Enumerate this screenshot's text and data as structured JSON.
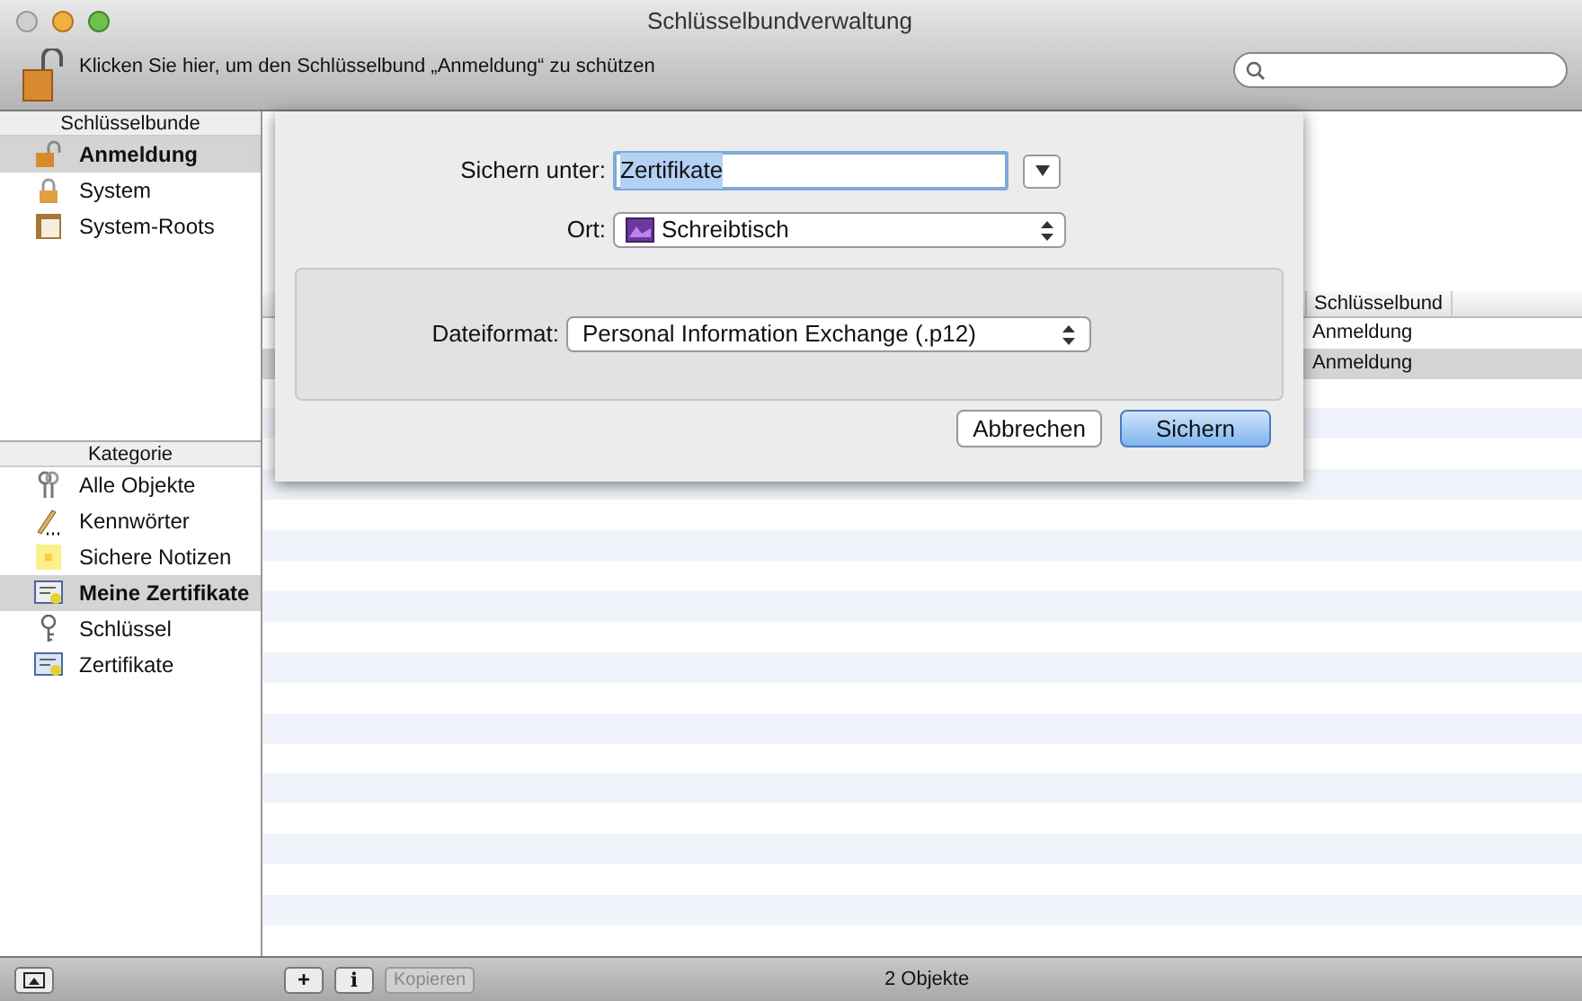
{
  "window": {
    "title": "Schlüsselbundverwaltung"
  },
  "toolbar": {
    "lock_text": "Klicken Sie hier, um den Schlüsselbund „Anmeldung“ zu schützen"
  },
  "keychains": {
    "header": "Schlüsselbunde",
    "items": [
      {
        "label": "Anmeldung",
        "kind": "lock-open",
        "selected": true
      },
      {
        "label": "System",
        "kind": "lock",
        "selected": false
      },
      {
        "label": "System-Roots",
        "kind": "cabinet",
        "selected": false
      }
    ]
  },
  "categories": {
    "header": "Kategorie",
    "items": [
      {
        "label": "Alle Objekte",
        "kind": "keys",
        "selected": false
      },
      {
        "label": "Kennwörter",
        "kind": "pencil",
        "selected": false
      },
      {
        "label": "Sichere Notizen",
        "kind": "note",
        "selected": false
      },
      {
        "label": "Meine Zertifikate",
        "kind": "mycert",
        "selected": true
      },
      {
        "label": "Schlüssel",
        "kind": "key",
        "selected": false
      },
      {
        "label": "Zertifikate",
        "kind": "cert",
        "selected": false
      }
    ]
  },
  "table": {
    "columns": [
      "Schlüsselbund"
    ],
    "rows": [
      {
        "keychain": "Anmeldung",
        "selected": false
      },
      {
        "keychain": "Anmeldung",
        "selected": true
      }
    ]
  },
  "sheet": {
    "save_as_label": "Sichern unter:",
    "save_as_value": "Zertifikate",
    "where_label": "Ort:",
    "where_value": "Schreibtisch",
    "format_label": "Dateiformat:",
    "format_value": "Personal Information Exchange (.p12)",
    "buttons": [
      {
        "label": "Abbrechen",
        "kind": "cancel"
      },
      {
        "label": "Sichern",
        "kind": "default"
      }
    ]
  },
  "bottom_bar": {
    "copy_button": {
      "label": "Kopieren",
      "disabled": true
    },
    "add_symbol": "+",
    "info_symbol": "i",
    "status": "2 Objekte"
  }
}
